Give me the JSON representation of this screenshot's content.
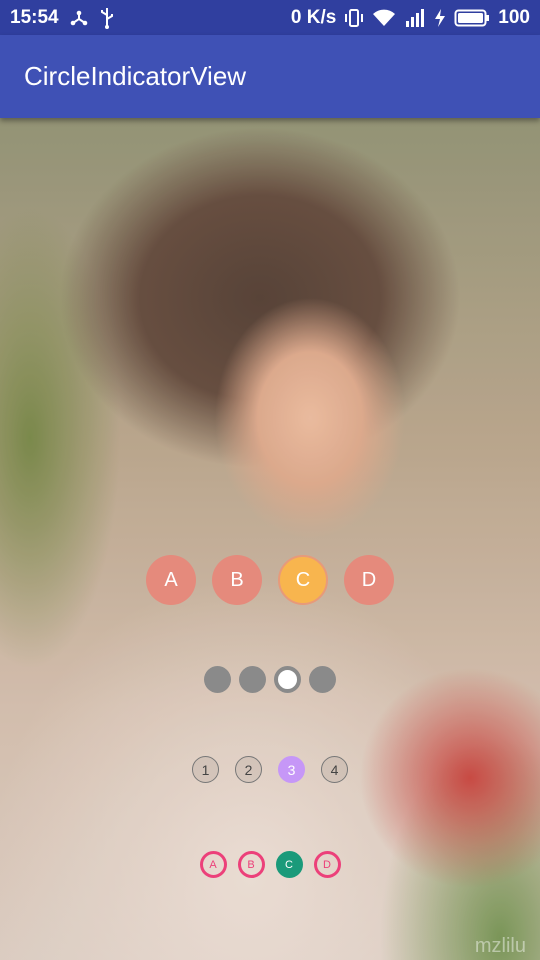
{
  "status_bar": {
    "time": "15:54",
    "net_speed": "0 K/s",
    "battery": "100",
    "colors": {
      "bg": "#303f9f"
    }
  },
  "app_bar": {
    "title": "CircleIndicatorView",
    "colors": {
      "bg": "#3f51b5"
    }
  },
  "photo": {
    "watermark": "mzlilu"
  },
  "indicator_letters_large": {
    "items": [
      "A",
      "B",
      "C",
      "D"
    ],
    "selected_index": 2,
    "colors": {
      "normal": "#e58a7c",
      "selected": "#f8b54e"
    }
  },
  "indicator_dots": {
    "count": 4,
    "selected_index": 2,
    "colors": {
      "normal": "#8a8a8a",
      "selected": "#ffffff"
    }
  },
  "indicator_numbers": {
    "items": [
      "1",
      "2",
      "3",
      "4"
    ],
    "selected_index": 2,
    "colors": {
      "selected": "#c697f7"
    }
  },
  "indicator_letters_small": {
    "items": [
      "A",
      "B",
      "C",
      "D"
    ],
    "selected_index": 2,
    "colors": {
      "ring": "#ec407a",
      "selected": "#1a9a7a"
    }
  }
}
